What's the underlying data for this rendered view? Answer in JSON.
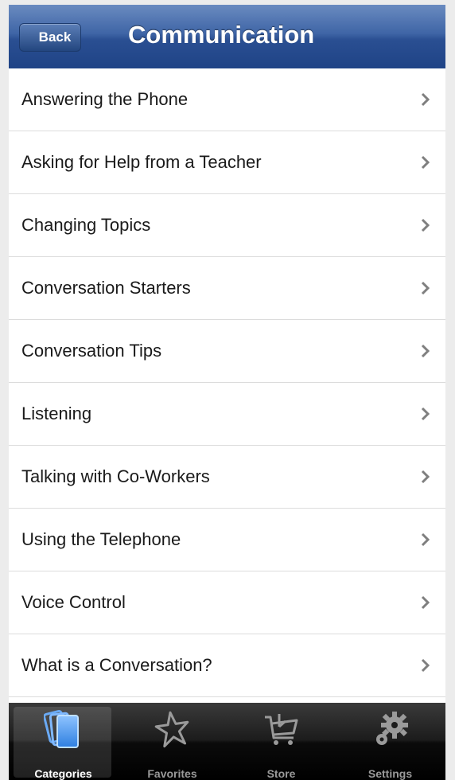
{
  "navbar": {
    "back_label": "Back",
    "title": "Communication"
  },
  "list": {
    "items": [
      {
        "label": "Answering the Phone"
      },
      {
        "label": "Asking for Help from a Teacher"
      },
      {
        "label": "Changing Topics"
      },
      {
        "label": "Conversation Starters"
      },
      {
        "label": "Conversation Tips"
      },
      {
        "label": "Listening"
      },
      {
        "label": "Talking with Co-Workers"
      },
      {
        "label": "Using the Telephone"
      },
      {
        "label": "Voice Control"
      },
      {
        "label": "What is a Conversation?"
      }
    ]
  },
  "tabbar": {
    "tabs": [
      {
        "label": "Categories",
        "icon": "categories-icon",
        "active": true
      },
      {
        "label": "Favorites",
        "icon": "star-icon",
        "active": false
      },
      {
        "label": "Store",
        "icon": "cart-icon",
        "active": false
      },
      {
        "label": "Settings",
        "icon": "gear-icon",
        "active": false
      }
    ]
  },
  "colors": {
    "navbar": "#2a4f92",
    "tabbar": "#1c1c1c",
    "chevron": "#7f7f7f"
  }
}
